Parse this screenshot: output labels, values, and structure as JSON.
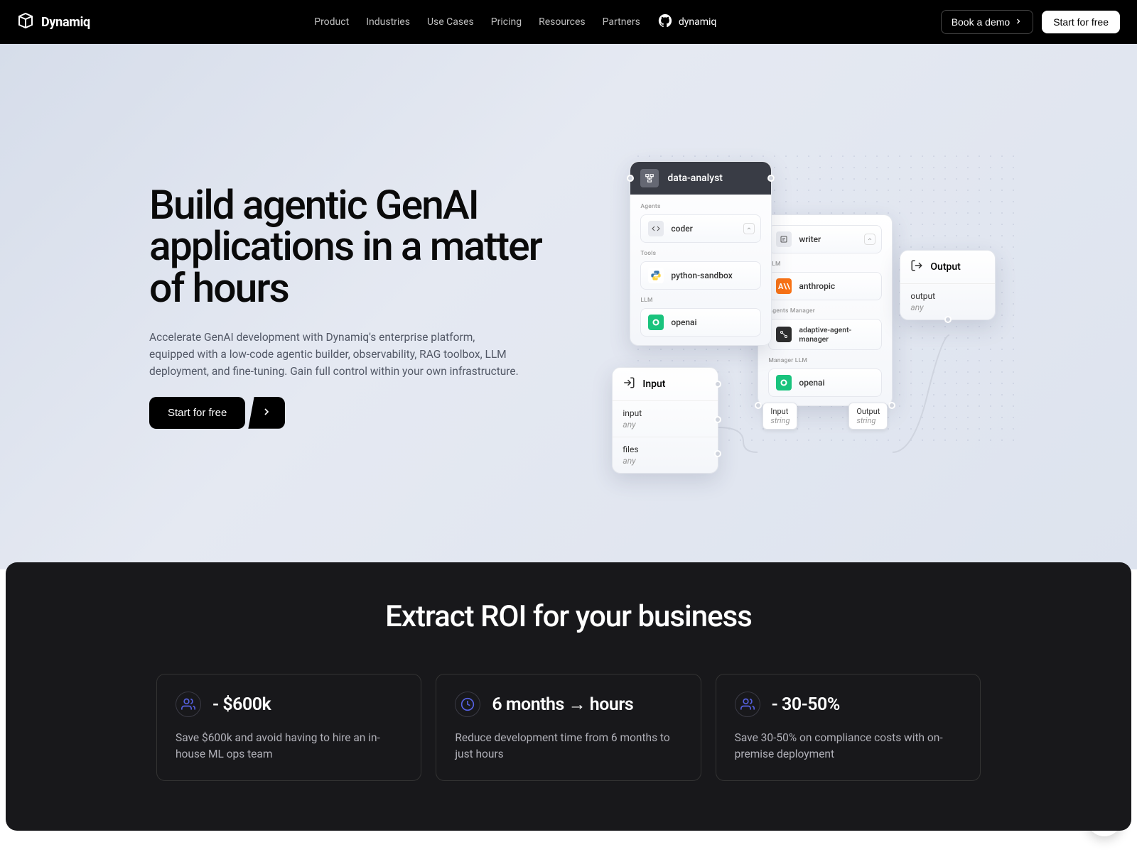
{
  "nav": {
    "brand": "Dynamiq",
    "links": [
      "Product",
      "Industries",
      "Use Cases",
      "Pricing",
      "Resources",
      "Partners"
    ],
    "github": "dynamiq",
    "demo_btn": "Book a demo",
    "free_btn": "Start for free"
  },
  "hero": {
    "title": "Build agentic GenAI applications in a matter of hours",
    "subtitle": "Accelerate GenAI development with Dynamiq's enterprise platform, equipped with a low-code agentic builder, observability, RAG toolbox, LLM deployment, and fine-tuning. Gain full control within your own infrastructure.",
    "cta": "Start for free"
  },
  "visual": {
    "analyst": {
      "title": "data-analyst",
      "sections": {
        "agents_label": "Agents",
        "agents_item": "coder",
        "tools_label": "Tools",
        "tools_item": "python-sandbox",
        "llm_label": "LLM",
        "llm_item": "openai"
      }
    },
    "writer": {
      "writer_item": "writer",
      "llm_label": "LLM",
      "llm_item": "anthropic",
      "manager_label": "Agents Manager",
      "manager_item": "adaptive-agent-manager",
      "mgr_llm_label": "Manager LLM",
      "mgr_llm_item": "openai",
      "port_in_name": "Input",
      "port_in_type": "string",
      "port_out_name": "Output",
      "port_out_type": "string"
    },
    "input": {
      "title": "Input",
      "field1_name": "input",
      "field1_type": "any",
      "field2_name": "files",
      "field2_type": "any"
    },
    "output": {
      "title": "Output",
      "field_name": "output",
      "field_type": "any"
    }
  },
  "roi": {
    "title": "Extract ROI for your business",
    "cards": [
      {
        "stat": "- $600k",
        "desc": "Save $600k and avoid having to hire an in-house ML ops team"
      },
      {
        "stat": "6 months → hours",
        "desc": "Reduce development time from 6 months to just hours"
      },
      {
        "stat": "- 30-50%",
        "desc": "Save 30-50% on compliance costs with on-premise deployment"
      }
    ]
  }
}
